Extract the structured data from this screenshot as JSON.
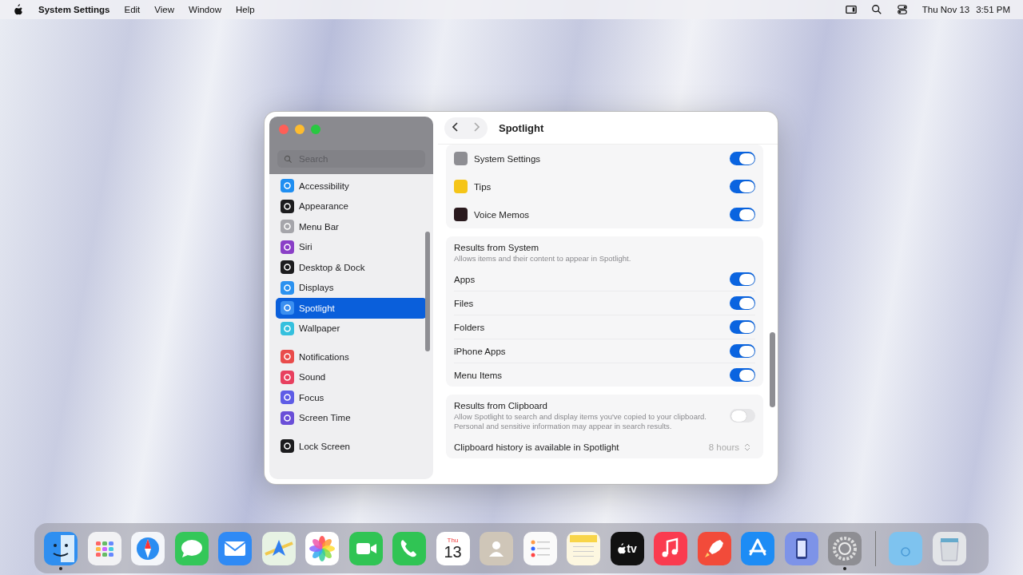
{
  "menu_bar": {
    "app_name": "System Settings",
    "menus": [
      "Edit",
      "View",
      "Window",
      "Help"
    ],
    "date": "Thu Nov 13",
    "time": "3:51 PM"
  },
  "window": {
    "title": "Spotlight",
    "sidebar": {
      "search": {
        "placeholder": "Search"
      },
      "groups": [
        [
          {
            "label": "Accessibility",
            "color": "#1f8ef1",
            "selected": false
          },
          {
            "label": "Appearance",
            "color": "#1c1c1e",
            "selected": false
          },
          {
            "label": "Menu Bar",
            "color": "#a5a5aa",
            "selected": false
          },
          {
            "label": "Siri",
            "color": "#8a3fc7",
            "selected": false
          },
          {
            "label": "Desktop & Dock",
            "color": "#1c1c1e",
            "selected": false
          },
          {
            "label": "Displays",
            "color": "#2b92f0",
            "selected": false
          },
          {
            "label": "Spotlight",
            "color": "#3b8ff0",
            "selected": true
          },
          {
            "label": "Wallpaper",
            "color": "#35c0de",
            "selected": false
          }
        ],
        [
          {
            "label": "Notifications",
            "color": "#e94b4b",
            "selected": false
          },
          {
            "label": "Sound",
            "color": "#e8405f",
            "selected": false
          },
          {
            "label": "Focus",
            "color": "#5e5ce6",
            "selected": false
          },
          {
            "label": "Screen Time",
            "color": "#6a4fd8",
            "selected": false
          }
        ],
        [
          {
            "label": "Lock Screen",
            "color": "#1c1c1e",
            "selected": false
          }
        ]
      ]
    },
    "sections": [
      {
        "rows": [
          {
            "label": "System Settings",
            "color": "#8e8e93",
            "on": true
          },
          {
            "label": "Tips",
            "color": "#f5c518",
            "on": true
          },
          {
            "label": "Voice Memos",
            "color": "#2a1a1e",
            "on": true
          }
        ]
      },
      {
        "title": "Results from System",
        "description": "Allows items and their content to appear in Spotlight.",
        "rows": [
          {
            "label": "Apps",
            "on": true
          },
          {
            "label": "Files",
            "on": true
          },
          {
            "label": "Folders",
            "on": true
          },
          {
            "label": "iPhone Apps",
            "on": true
          },
          {
            "label": "Menu Items",
            "on": true
          }
        ]
      },
      {
        "title": "Results from Clipboard",
        "description": "Allow Spotlight to search and display items you've copied to your clipboard. Personal and sensitive information may appear in search results.",
        "on": false,
        "rows": [
          {
            "label": "Clipboard history is available in Spotlight",
            "value": "8 hours"
          }
        ]
      }
    ]
  },
  "dock": {
    "apps": [
      {
        "kind": "finder",
        "running": true
      },
      {
        "kind": "launchpad",
        "running": false
      },
      {
        "kind": "safari",
        "running": false
      },
      {
        "kind": "messages",
        "running": false
      },
      {
        "kind": "mail",
        "running": false
      },
      {
        "kind": "maps",
        "running": false
      },
      {
        "kind": "photos",
        "running": false
      },
      {
        "kind": "facetime",
        "running": false
      },
      {
        "kind": "phone",
        "running": false
      },
      {
        "kind": "calendar",
        "weekday": "Thu",
        "day": "13",
        "running": false
      },
      {
        "kind": "contacts",
        "running": false
      },
      {
        "kind": "reminders",
        "running": false
      },
      {
        "kind": "notes",
        "running": false
      },
      {
        "kind": "tv",
        "label": "tv",
        "running": false
      },
      {
        "kind": "music",
        "running": false
      },
      {
        "kind": "rocket",
        "running": false
      },
      {
        "kind": "appstore",
        "running": false
      },
      {
        "kind": "mirroring",
        "running": false
      },
      {
        "kind": "settings",
        "running": true
      }
    ],
    "others": [
      {
        "kind": "folder"
      },
      {
        "kind": "trash"
      }
    ]
  }
}
